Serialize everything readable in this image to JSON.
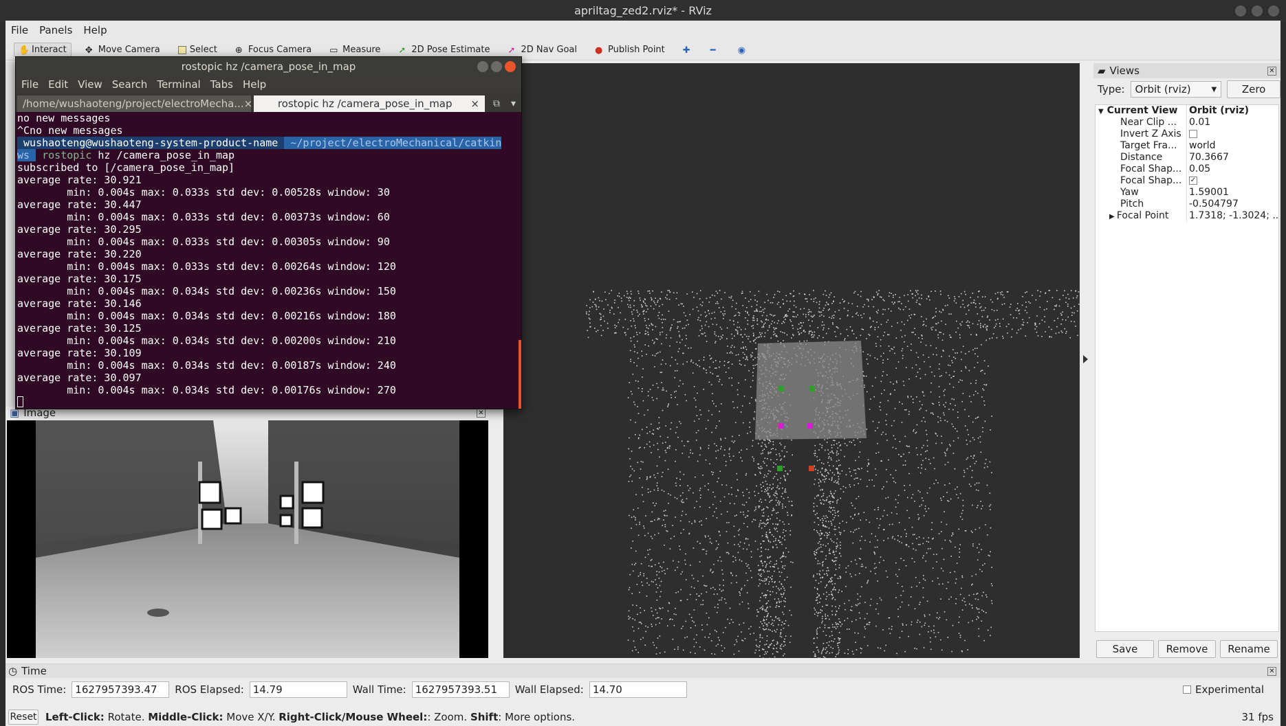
{
  "window": {
    "title": "apriltag_zed2.rviz* - RViz"
  },
  "menubar": {
    "items": [
      "File",
      "Panels",
      "Help"
    ]
  },
  "toolbar": {
    "tools": [
      "Interact",
      "Move Camera",
      "Select",
      "Focus Camera",
      "Measure",
      "2D Pose Estimate",
      "2D Nav Goal",
      "Publish Point"
    ]
  },
  "terminal": {
    "title": "rostopic hz /camera_pose_in_map",
    "menu": [
      "File",
      "Edit",
      "View",
      "Search",
      "Terminal",
      "Tabs",
      "Help"
    ],
    "tabs": [
      {
        "label": "/home/wushaoteng/project/electroMecha..."
      },
      {
        "label": "rostopic hz /camera_pose_in_map"
      }
    ],
    "prompt_user": " wushaoteng@wushaoteng-system-product-name ",
    "prompt_path": " ~/project/electroMechanical/catkin",
    "prompt_path2": "ws ",
    "command": " rostopic",
    "command_args": " hz /camera_pose_in_map",
    "lines_before": [
      "no new messages",
      "^Cno new messages"
    ],
    "lines_after": [
      "subscribed to [/camera_pose_in_map]",
      "average rate: 30.921",
      "        min: 0.004s max: 0.033s std dev: 0.00528s window: 30",
      "average rate: 30.447",
      "        min: 0.004s max: 0.033s std dev: 0.00373s window: 60",
      "average rate: 30.295",
      "        min: 0.004s max: 0.033s std dev: 0.00305s window: 90",
      "average rate: 30.220",
      "        min: 0.004s max: 0.033s std dev: 0.00264s window: 120",
      "average rate: 30.175",
      "        min: 0.004s max: 0.034s std dev: 0.00236s window: 150",
      "average rate: 30.146",
      "        min: 0.004s max: 0.034s std dev: 0.00216s window: 180",
      "average rate: 30.125",
      "        min: 0.004s max: 0.034s std dev: 0.00200s window: 210",
      "average rate: 30.109",
      "        min: 0.004s max: 0.034s std dev: 0.00187s window: 240",
      "average rate: 30.097",
      "        min: 0.004s max: 0.034s std dev: 0.00176s window: 270"
    ]
  },
  "image_panel": {
    "title": "Image"
  },
  "views_panel": {
    "title": "Views",
    "type_label": "Type:",
    "type_value": "Orbit (rviz)",
    "zero_label": "Zero",
    "current_view_label": "Current View",
    "current_view_value": "Orbit (rviz)",
    "properties": [
      {
        "key": "Near Clip ...",
        "value": "0.01"
      },
      {
        "key": "Invert Z Axis",
        "value": "",
        "checkbox": false
      },
      {
        "key": "Target Fra...",
        "value": "world"
      },
      {
        "key": "Distance",
        "value": "70.3667"
      },
      {
        "key": "Focal Shap...",
        "value": "0.05"
      },
      {
        "key": "Focal Shap...",
        "value": "",
        "checkbox": true
      },
      {
        "key": "Yaw",
        "value": "1.59001"
      },
      {
        "key": "Pitch",
        "value": "-0.504797"
      },
      {
        "key": "Focal Point",
        "value": "1.7318; -1.3024; ..."
      }
    ],
    "save_label": "Save",
    "remove_label": "Remove",
    "rename_label": "Rename"
  },
  "time_panel": {
    "title": "Time",
    "ros_time_label": "ROS Time:",
    "ros_time": "1627957393.47",
    "ros_elapsed_label": "ROS Elapsed:",
    "ros_elapsed": "14.79",
    "wall_time_label": "Wall Time:",
    "wall_time": "1627957393.51",
    "wall_elapsed_label": "Wall Elapsed:",
    "wall_elapsed": "14.70",
    "experimental_label": "Experimental"
  },
  "statusbar": {
    "reset_label": "Reset",
    "hint_lc": "Left-Click:",
    "hint_lc_t": " Rotate. ",
    "hint_mc": "Middle-Click:",
    "hint_mc_t": " Move X/Y. ",
    "hint_rc": "Right-Click/Mouse Wheel:",
    "hint_rc_t": ": Zoom. ",
    "hint_sh": "Shift",
    "hint_sh_t": ": More options.",
    "fps": "31 fps"
  }
}
